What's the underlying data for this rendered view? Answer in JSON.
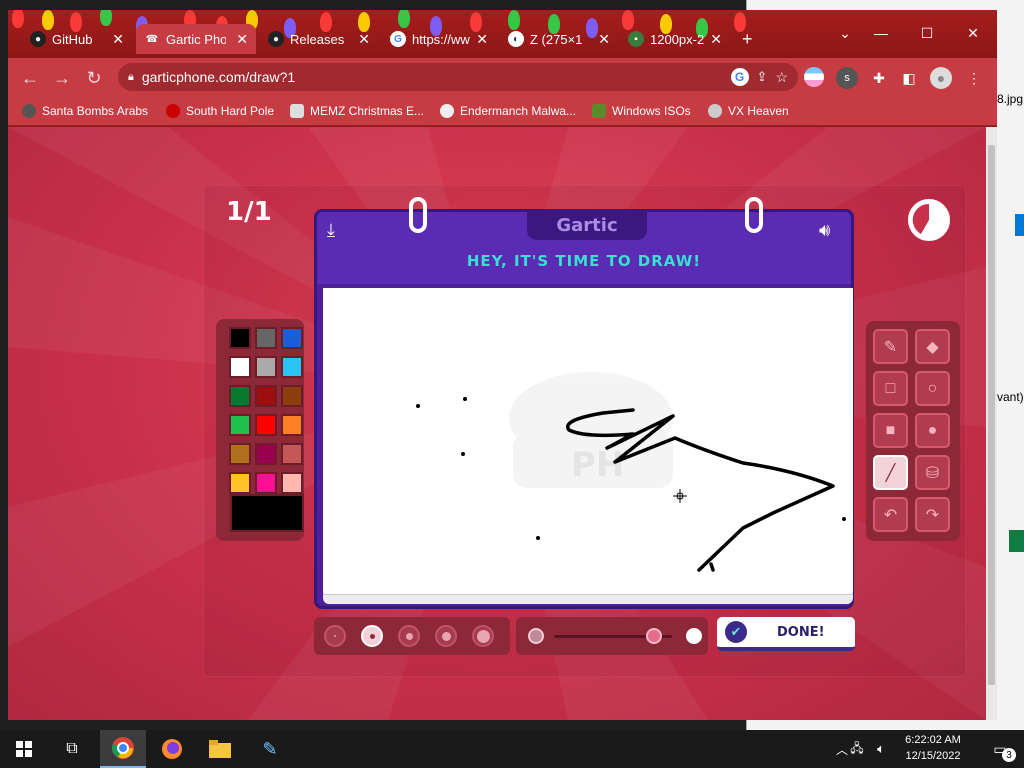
{
  "browser": {
    "tabs": [
      {
        "title": "GitHub",
        "icon": "github-icon",
        "active": false
      },
      {
        "title": "Gartic Phone",
        "icon": "phone-icon",
        "active": true
      },
      {
        "title": "Releases",
        "icon": "github-icon",
        "active": false
      },
      {
        "title": "https://www",
        "icon": "google-icon",
        "active": false
      },
      {
        "title": "Z (275×1",
        "icon": "z-icon",
        "active": false
      },
      {
        "title": "1200px-2",
        "icon": "image-icon",
        "active": false
      }
    ],
    "new_tab_label": "+",
    "url": "garticphone.com/draw?1",
    "profile_initial": "s",
    "bookmarks": [
      {
        "label": "Santa Bombs Arabs",
        "icon": "bomb-icon"
      },
      {
        "label": "South Hard Pole",
        "icon": "pole-icon"
      },
      {
        "label": "MEMZ Christmas E...",
        "icon": "memz-icon"
      },
      {
        "label": "Endermanch Malwa...",
        "icon": "endermanch-icon"
      },
      {
        "label": "Windows ISOs",
        "icon": "tree-icon"
      },
      {
        "label": "VX Heaven",
        "icon": "vx-icon"
      }
    ]
  },
  "background_window": {
    "file_text": "8.jpg",
    "side_text": "vant)"
  },
  "game": {
    "round": "1/1",
    "logo": "Gartic",
    "instruction": "HEY, IT'S TIME TO DRAW!",
    "done_label": "DONE!",
    "palette_colors": [
      "#000000",
      "#666666",
      "#1a5fd6",
      "#ffffff",
      "#aaaaaa",
      "#2ac5f4",
      "#087a2e",
      "#9e0e0e",
      "#8c3f0d",
      "#1ec050",
      "#ff0000",
      "#ff7f27",
      "#b0701e",
      "#99004d",
      "#c45858",
      "#ffc125",
      "#ff0f94",
      "#ffb8b0"
    ],
    "current_color": "#000000",
    "selected_tool": "line",
    "selected_size": 2,
    "opacity_level": 0.85
  },
  "taskbar": {
    "time": "6:22:02 AM",
    "date": "12/15/2022",
    "notification_count": "3"
  }
}
